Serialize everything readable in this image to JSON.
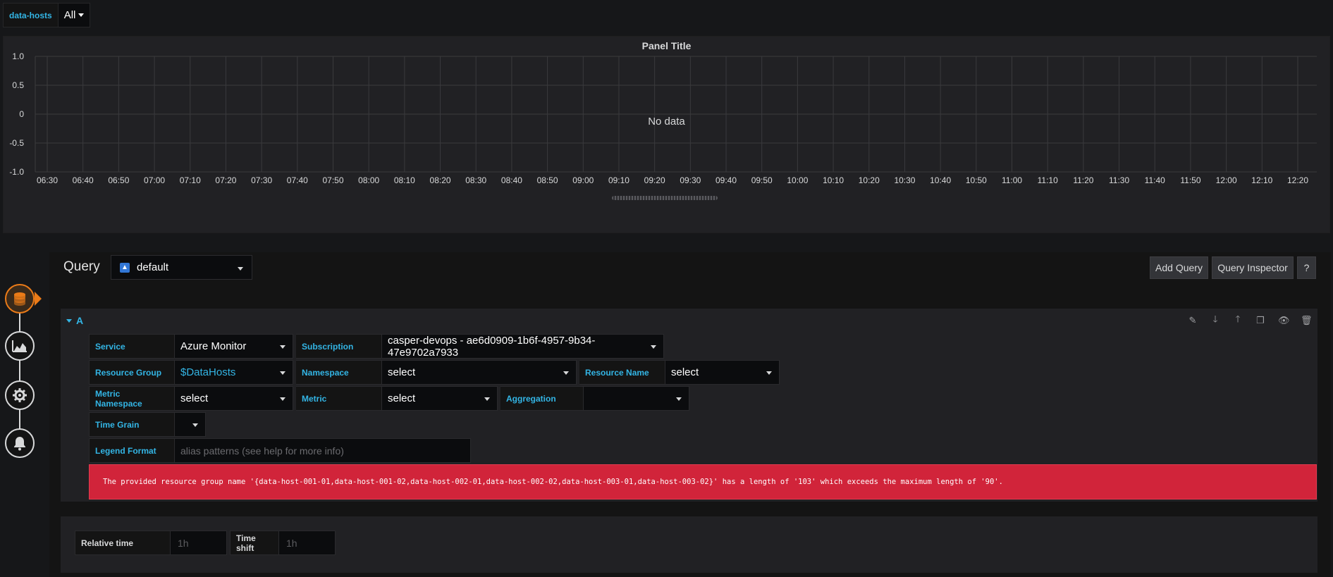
{
  "variables": {
    "label": "data-hosts",
    "value": "All"
  },
  "panel": {
    "title": "Panel Title",
    "no_data": "No data"
  },
  "chart_data": {
    "type": "line",
    "title": "Panel Title",
    "x_ticks": [
      "06:30",
      "06:40",
      "06:50",
      "07:00",
      "07:10",
      "07:20",
      "07:30",
      "07:40",
      "07:50",
      "08:00",
      "08:10",
      "08:20",
      "08:30",
      "08:40",
      "08:50",
      "09:00",
      "09:10",
      "09:20",
      "09:30",
      "09:40",
      "09:50",
      "10:00",
      "10:10",
      "10:20",
      "10:30",
      "10:40",
      "10:50",
      "11:00",
      "11:10",
      "11:20",
      "11:30",
      "11:40",
      "11:50",
      "12:00",
      "12:10",
      "12:20"
    ],
    "y_ticks": [
      "1.0",
      "0.5",
      "0",
      "-0.5",
      "-1.0"
    ],
    "ylim": [
      -1.0,
      1.0
    ],
    "series": [],
    "grid": true
  },
  "editor": {
    "query_label": "Query",
    "datasource": "default",
    "add_query": "Add Query",
    "query_inspector": "Query Inspector",
    "help": "?"
  },
  "query": {
    "name": "A",
    "service_label": "Service",
    "service_value": "Azure Monitor",
    "subscription_label": "Subscription",
    "subscription_value": "casper-devops - ae6d0909-1b6f-4957-9b34-47e9702a7933",
    "resource_group_label": "Resource Group",
    "resource_group_value": "$DataHosts",
    "namespace_label": "Namespace",
    "namespace_value": "select",
    "resource_name_label": "Resource Name",
    "resource_name_value": "select",
    "metric_namespace_label": "Metric Namespace",
    "metric_namespace_value": "select",
    "metric_label": "Metric",
    "metric_value": "select",
    "aggregation_label": "Aggregation",
    "aggregation_value": "",
    "time_grain_label": "Time Grain",
    "legend_format_label": "Legend Format",
    "legend_format_placeholder": "alias patterns (see help for more info)",
    "error": "The provided resource group name '{data-host-001-01,data-host-001-02,data-host-002-01,data-host-002-02,data-host-003-01,data-host-003-02}' has a length of '103' which exceeds the maximum length of '90'."
  },
  "options": {
    "relative_time_label": "Relative time",
    "relative_time_placeholder": "1h",
    "time_shift_label": "Time shift",
    "time_shift_placeholder": "1h"
  }
}
